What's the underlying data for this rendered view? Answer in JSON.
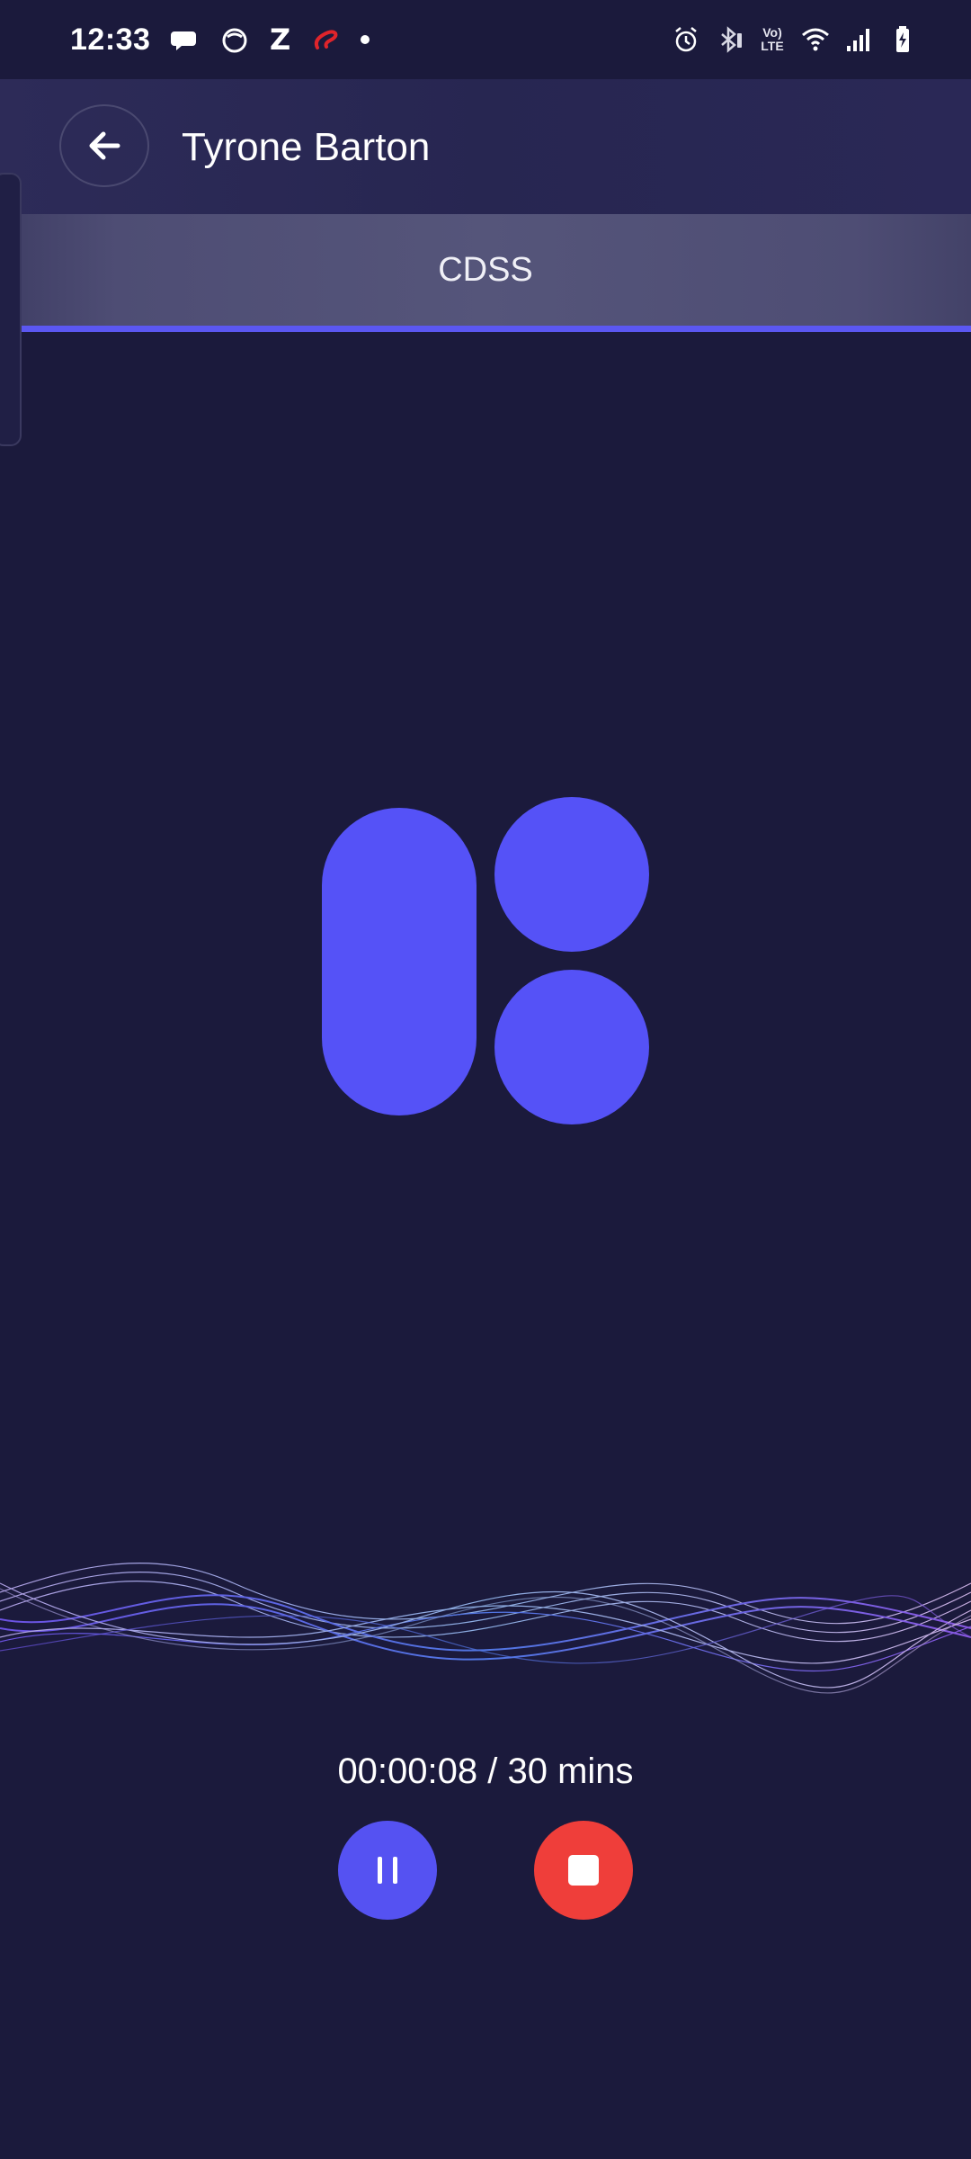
{
  "status_bar": {
    "time": "12:33",
    "notification_icons": [
      "chat-bubble-icon",
      "cat-face-icon",
      "z-app-icon",
      "airtel-logo-icon",
      "dot-icon"
    ],
    "z_letter": "Z",
    "volte_top": "Vo)",
    "volte_bottom": "LTE",
    "system_icons": [
      "alarm-icon",
      "bluetooth-icon",
      "volte-icon",
      "wifi-icon",
      "signal-icon",
      "battery-charging-icon"
    ]
  },
  "header": {
    "title": "Tyrone Barton",
    "back_icon": "arrow-left-icon"
  },
  "tabs": {
    "active_label": "CDSS"
  },
  "recorder": {
    "timer": "00:00:08 / 30 mins",
    "pause_icon": "pause-icon",
    "stop_icon": "stop-icon"
  },
  "colors": {
    "background": "#1b1a3c",
    "accent": "#5552f7",
    "stop": "#ef3e3a",
    "tab_indicator": "#5b57f2"
  }
}
